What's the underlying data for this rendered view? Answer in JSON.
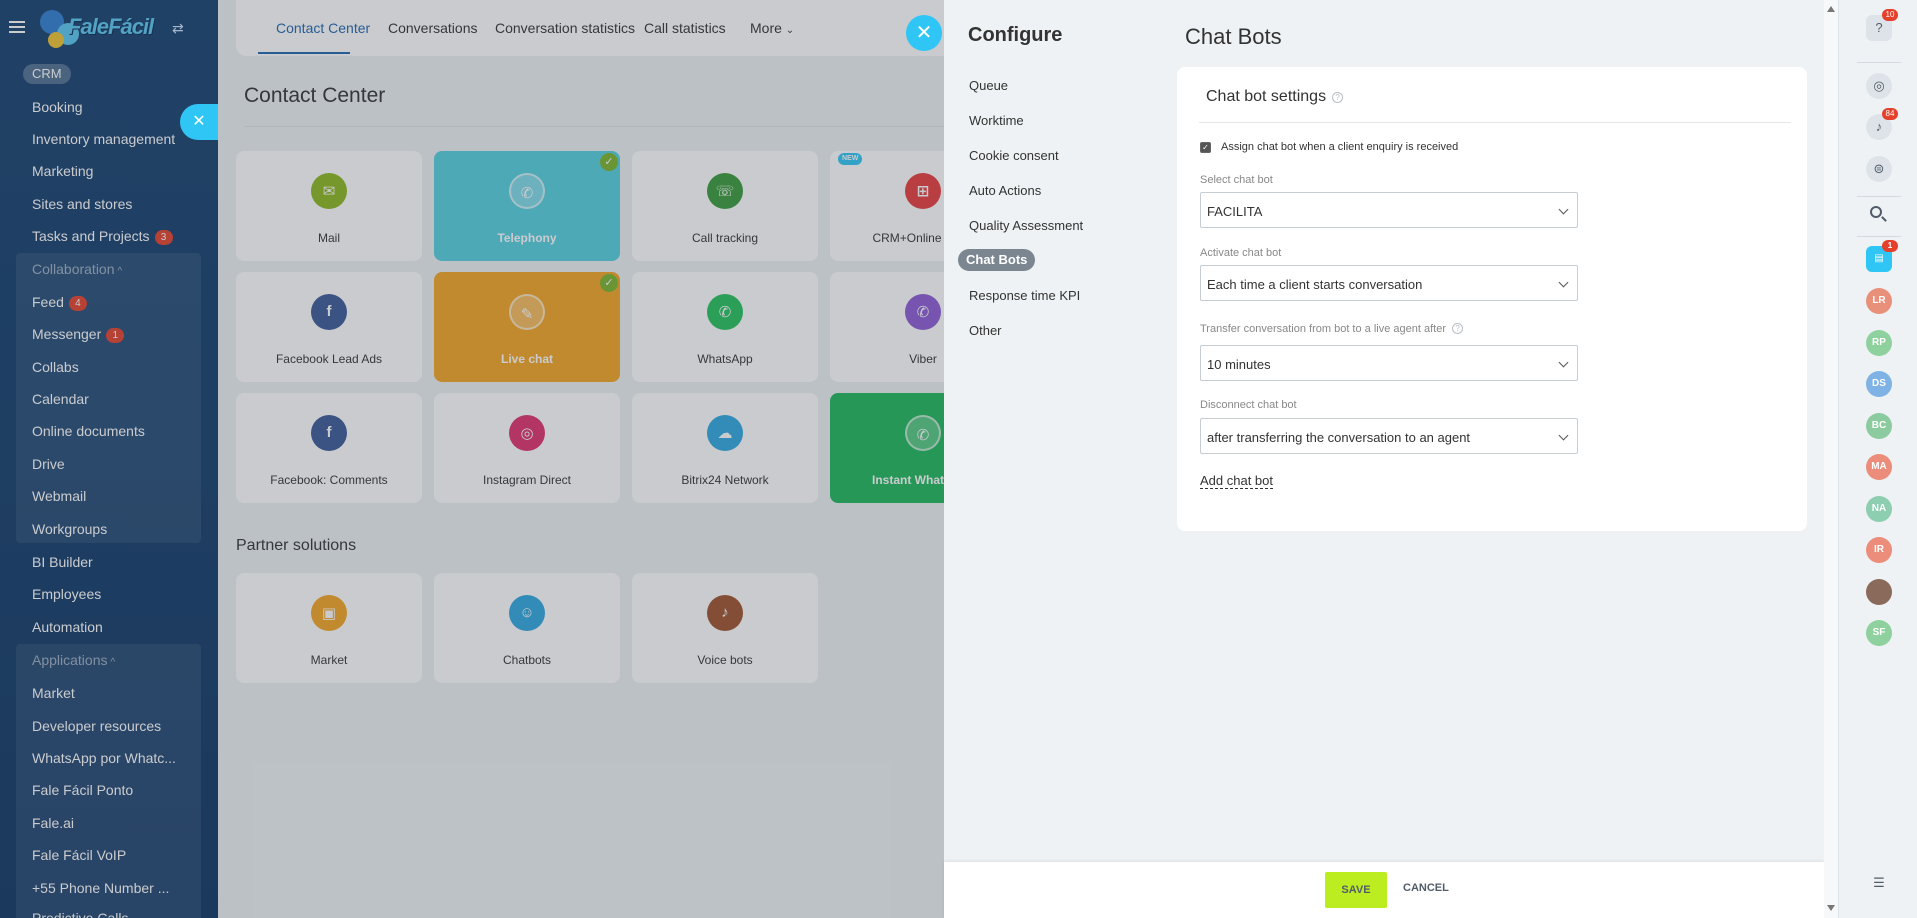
{
  "nav": {
    "brand": "FaleFácil",
    "crm": "CRM",
    "items_top": [
      "Booking",
      "Inventory management",
      "Marketing",
      "Sites and stores"
    ],
    "tasks": {
      "label": "Tasks and Projects",
      "count": "3"
    },
    "collaboration": {
      "title": "Collaboration",
      "feed": {
        "label": "Feed",
        "count": "4"
      },
      "messenger": {
        "label": "Messenger",
        "count": "1"
      },
      "items": [
        "Collabs",
        "Calendar",
        "Online documents",
        "Drive",
        "Webmail",
        "Workgroups"
      ]
    },
    "items_mid": [
      "BI Builder",
      "Employees",
      "Automation"
    ],
    "applications": {
      "title": "Applications",
      "items": [
        "Market",
        "Developer resources",
        "WhatsApp por Whatc...",
        "Fale Fácil Ponto",
        "Fale.ai",
        "Fale Fácil VoIP",
        "+55 Phone Number ...",
        "Predictive Calls"
      ]
    }
  },
  "center": {
    "tabs": [
      "Contact Center",
      "Conversations",
      "Conversation statistics",
      "Call statistics",
      "More"
    ],
    "page_title": "Contact Center",
    "tiles": [
      {
        "label": "Mail",
        "color": "#8cb71e",
        "glyph": "✉"
      },
      {
        "label": "Telephony",
        "color": "#55d0e0",
        "glyph": "✆"
      },
      {
        "label": "Call tracking",
        "color": "#3a9a3a",
        "glyph": "☏"
      },
      {
        "label": "CRM+Online Store",
        "color": "#e93c3c",
        "glyph": "⊞"
      },
      {
        "label": "Facebook Lead Ads",
        "color": "#3b5998",
        "glyph": "f"
      },
      {
        "label": "Live chat",
        "color": "#f5a623",
        "glyph": "✎"
      },
      {
        "label": "WhatsApp",
        "color": "#25c35a",
        "glyph": "✆"
      },
      {
        "label": "Viber",
        "color": "#8e5bd4",
        "glyph": "✆"
      },
      {
        "label": "Facebook: Comments",
        "color": "#3b5998",
        "glyph": "f"
      },
      {
        "label": "Instagram Direct",
        "color": "#e1306c",
        "glyph": "◎"
      },
      {
        "label": "Bitrix24 Network",
        "color": "#2fa8e0",
        "glyph": "☁"
      },
      {
        "label": "Instant WhatsApp",
        "color": "#1eb85a",
        "glyph": "✆"
      }
    ],
    "new_badge": "NEW",
    "partner_title": "Partner solutions",
    "partner_tiles": [
      {
        "label": "Market",
        "color": "#f5a623",
        "glyph": "▣"
      },
      {
        "label": "Chatbots",
        "color": "#2fa8e0",
        "glyph": "☺"
      },
      {
        "label": "Voice bots",
        "color": "#a0522d",
        "glyph": "♪"
      }
    ]
  },
  "config": {
    "title": "Configure",
    "menu": [
      "Queue",
      "Worktime",
      "Cookie consent",
      "Auto Actions",
      "Quality Assessment",
      "Chat Bots",
      "Response time KPI",
      "Other"
    ],
    "page_title": "Chat Bots",
    "card_title": "Chat bot settings",
    "assign_label": "Assign chat bot when a client enquiry is received",
    "select_label": "Select chat bot",
    "select_value": "FACILITA",
    "activate_label": "Activate chat bot",
    "activate_value": "Each time a client starts conversation",
    "transfer_label": "Transfer conversation from bot to a live agent after",
    "transfer_value": "10 minutes",
    "disconnect_label": "Disconnect chat bot",
    "disconnect_value": "after transferring the conversation to an agent",
    "add_bot": "Add chat bot",
    "save": "SAVE",
    "cancel": "CANCEL"
  },
  "rail": {
    "help_badge": "10",
    "notif_badge": "84",
    "chat_badge": "1",
    "avatars": [
      {
        "initials": "LR",
        "color": "#e8907a"
      },
      {
        "initials": "RP",
        "color": "#8fd19e"
      },
      {
        "initials": "DS",
        "color": "#7fb3e6"
      },
      {
        "initials": "BC",
        "color": "#8ccaa0"
      },
      {
        "initials": "MA",
        "color": "#ec8c7a"
      },
      {
        "initials": "NA",
        "color": "#8dcdb0"
      },
      {
        "initials": "IR",
        "color": "#ec8c7a"
      },
      {
        "initials": "",
        "color": "#8a6a5a"
      },
      {
        "initials": "SF",
        "color": "#8fd19e"
      }
    ]
  },
  "colors": {
    "accent": "#2fc6f6",
    "save": "#bbed21",
    "badge": "#e5402b"
  }
}
